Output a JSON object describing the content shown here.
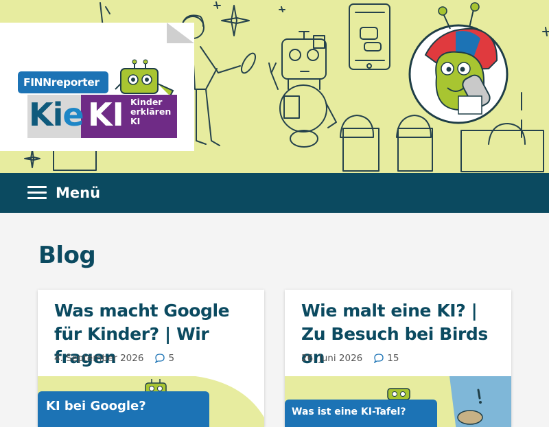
{
  "header": {
    "logo": {
      "finn_tag": "FINNreporter",
      "kie": "Kie",
      "ki": "KI",
      "subtitle_lines": [
        "Kinder",
        "erklären",
        "KI"
      ]
    }
  },
  "nav": {
    "menu_label": "Menü"
  },
  "main": {
    "heading": "Blog",
    "posts": [
      {
        "title": "Was macht Google für Kinder? | Wir fragen",
        "date": "4. September 2026",
        "comments": "5",
        "thumbnail_label": "KI bei Google?"
      },
      {
        "title": "Wie malt eine KI? | Zu Besuch bei Birds on",
        "date": "26. Juni 2026",
        "comments": "15",
        "thumbnail_label": "Was ist eine KI-Tafel?"
      }
    ]
  },
  "colors": {
    "hero_bg": "#e7ec9f",
    "nav_bg": "#0b4a60",
    "heading": "#0b4a60",
    "brand_blue": "#1c73b5",
    "brand_purple": "#6f2b86"
  }
}
